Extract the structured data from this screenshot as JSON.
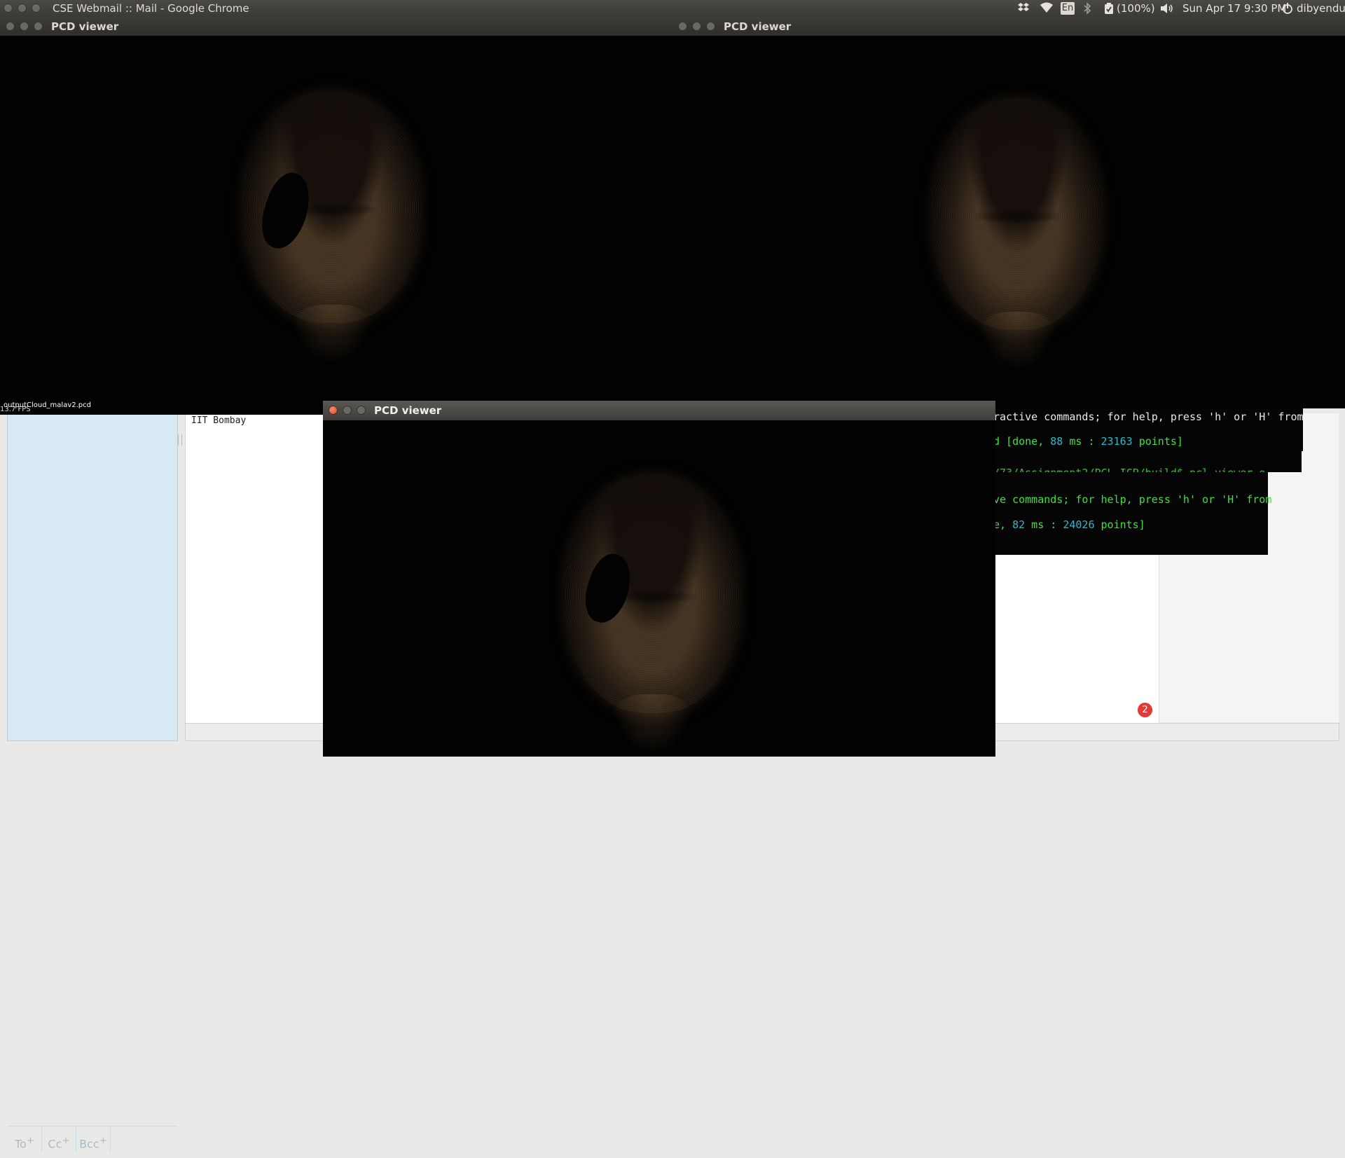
{
  "topbar": {
    "window_title": "CSE Webmail :: Mail - Google Chrome",
    "keyboard": "En",
    "battery": "(100%)",
    "datetime": "Sun Apr 17  9:30 PM",
    "user": "dibyendu",
    "icons": [
      "dropbox-icon",
      "wifi-icon",
      "keyboard-layout-icon",
      "bluetooth-icon",
      "battery-icon",
      "volume-icon",
      "session-icon"
    ]
  },
  "viewer_left": {
    "title": "PCD viewer",
    "file_label": "outputCloud_malav2.pcd",
    "fps": "13.7 FPS"
  },
  "viewer_right": {
    "title": "PCD viewer"
  },
  "viewer_bottom": {
    "title": "PCD viewer"
  },
  "terminal": {
    "line1": "ractive commands; for help, press 'h' or 'H' from",
    "line2_pre": "d [done, ",
    "line2_ms": "88",
    "line2_mid": " ms : ",
    "line2_pts": "23163",
    "line2_post": " points]",
    "line3": "/73/Assignment2/PCL_ICP/build$ pcl_viewer o",
    "line4": "ve commands; for help, press 'h' or 'H' from",
    "line5_pre": "e, ",
    "line5_ms": "82",
    "line5_mid": " ms : ",
    "line5_pts": "24026",
    "line5_post": " points]"
  },
  "mail": {
    "body_text": "IIT Bombay",
    "to_label": "To",
    "cc_label": "Cc",
    "bcc_label": "Bcc",
    "notification_count": "2",
    "accent_blue": "#d7eaf3",
    "badge_red": "#e53935"
  }
}
